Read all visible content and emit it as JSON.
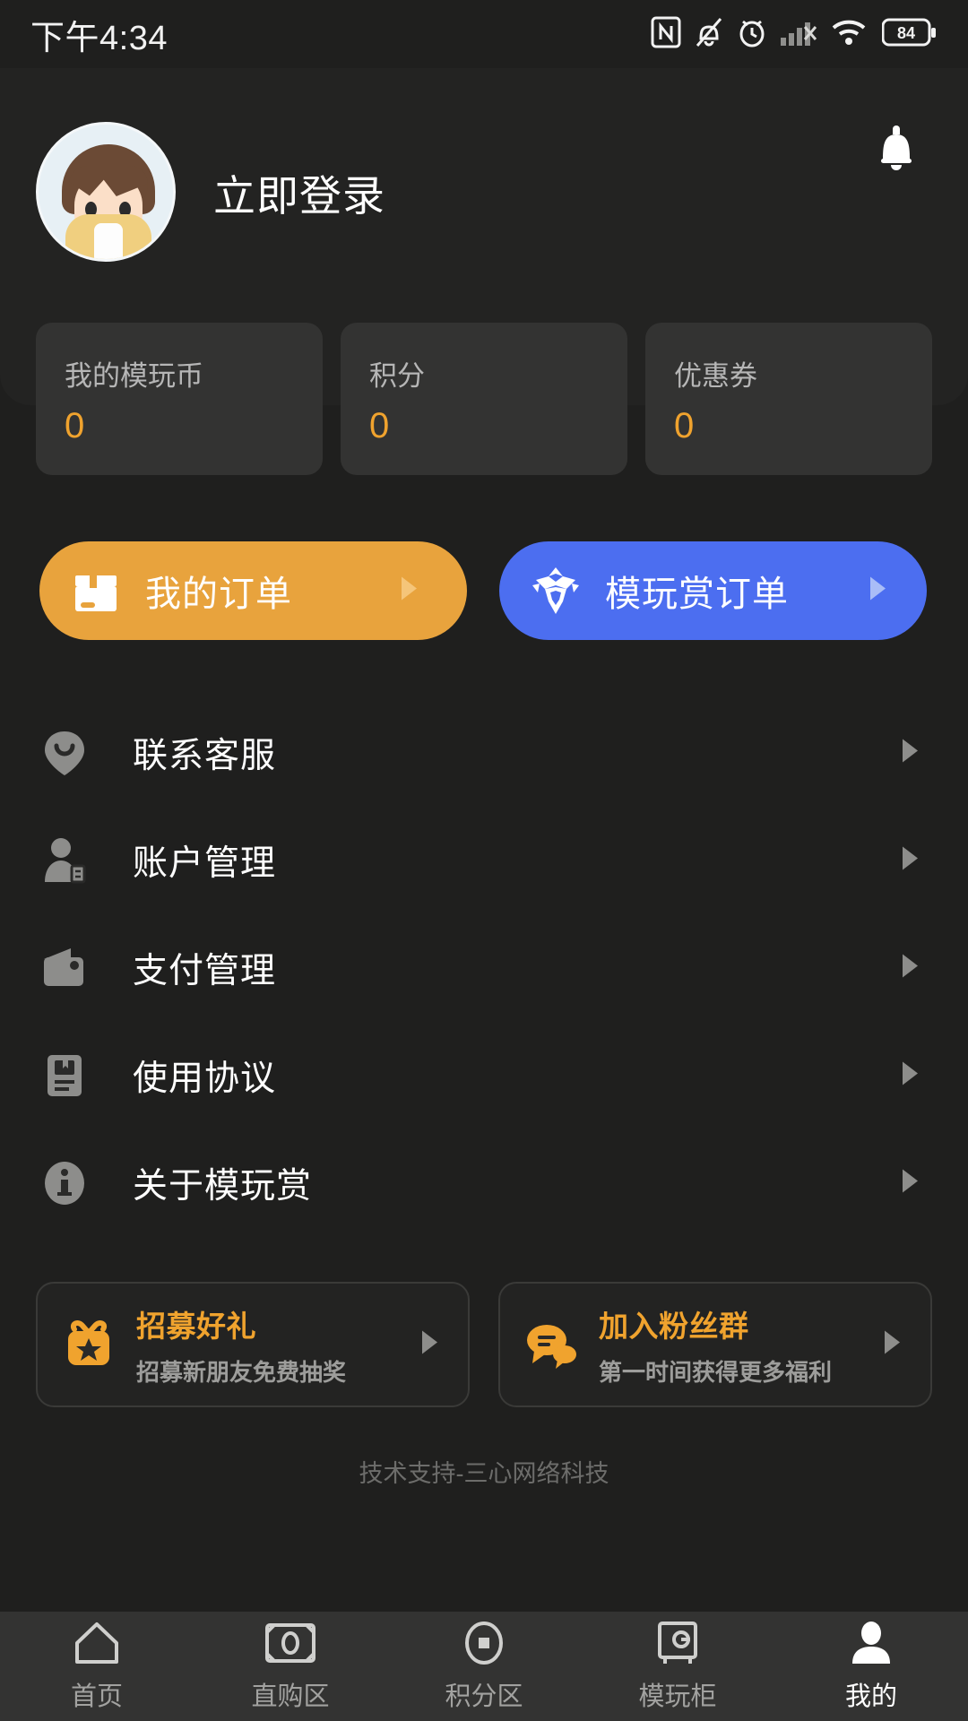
{
  "theme": {
    "bg": "#1f1f1e",
    "panel": "#232322",
    "card": "#333332",
    "accent_orange": "#f0a32e",
    "accent_blue": "#4c6ef0",
    "text_primary": "#ffffff",
    "text_muted": "#9d9d9b"
  },
  "statusbar": {
    "time": "下午4:34",
    "battery_percent": "84",
    "icons": [
      "nfc-icon",
      "bell-muted-icon",
      "alarm-icon",
      "signal-off-icon",
      "wifi-icon",
      "battery-icon"
    ]
  },
  "header": {
    "login_label": "立即登录",
    "avatar_name": "user-avatar",
    "bell_icon": "bell-icon"
  },
  "stats": [
    {
      "label": "我的模玩币",
      "value": "0"
    },
    {
      "label": "积分",
      "value": "0"
    },
    {
      "label": "优惠券",
      "value": "0"
    }
  ],
  "orders": [
    {
      "label": "我的订单",
      "icon": "package-box-icon",
      "color": "#e8a33d"
    },
    {
      "label": "模玩赏订单",
      "icon": "mecha-head-icon",
      "color": "#4c6ef0"
    }
  ],
  "menu": [
    {
      "label": "联系客服",
      "icon": "support-smiley-pin-icon"
    },
    {
      "label": "账户管理",
      "icon": "account-person-card-icon"
    },
    {
      "label": "支付管理",
      "icon": "wallet-icon"
    },
    {
      "label": "使用协议",
      "icon": "agreement-document-icon"
    },
    {
      "label": "关于模玩赏",
      "icon": "info-circle-icon"
    }
  ],
  "promos": [
    {
      "title": "招募好礼",
      "subtitle": "招募新朋友免费抽奖",
      "icon": "gift-star-icon"
    },
    {
      "title": "加入粉丝群",
      "subtitle": "第一时间获得更多福利",
      "icon": "chat-bubbles-icon"
    }
  ],
  "footer": {
    "note": "技术支持-三心网络科技"
  },
  "tabbar": {
    "items": [
      {
        "label": "首页",
        "icon": "home-icon",
        "active": false
      },
      {
        "label": "直购区",
        "icon": "banknote-icon",
        "active": false
      },
      {
        "label": "积分区",
        "icon": "coin-icon",
        "active": false
      },
      {
        "label": "模玩柜",
        "icon": "safe-cabinet-icon",
        "active": false
      },
      {
        "label": "我的",
        "icon": "person-icon",
        "active": true
      }
    ]
  }
}
